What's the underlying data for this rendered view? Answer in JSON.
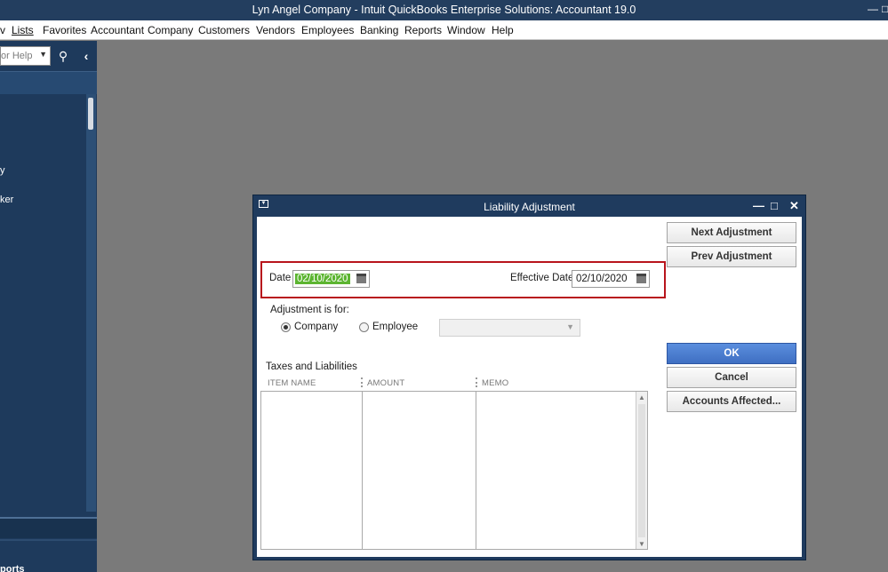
{
  "app": {
    "window_title": "Lyn Angel Company  - Intuit QuickBooks Enterprise Solutions: Accountant 19.0"
  },
  "menu": {
    "items": [
      {
        "id": "view-partial",
        "label": "v"
      },
      {
        "id": "lists",
        "label": "Lists"
      },
      {
        "id": "favorites",
        "label": "Favorites"
      },
      {
        "id": "accountant",
        "label": "Accountant"
      },
      {
        "id": "company",
        "label": "Company"
      },
      {
        "id": "customers",
        "label": "Customers"
      },
      {
        "id": "vendors",
        "label": "Vendors"
      },
      {
        "id": "employees",
        "label": "Employees"
      },
      {
        "id": "banking",
        "label": "Banking"
      },
      {
        "id": "reports",
        "label": "Reports"
      },
      {
        "id": "window",
        "label": "Window"
      },
      {
        "id": "help",
        "label": "Help"
      }
    ]
  },
  "sidebar": {
    "search_placeholder": "or Help",
    "nav_partial_1": "y",
    "nav_partial_2": "ker",
    "bottom_partial": "ports"
  },
  "dialog": {
    "title": "Liability Adjustment",
    "date_label": "Date",
    "date_value": "02/10/2020",
    "effective_date_label": "Effective Date",
    "effective_date_value": "02/10/2020",
    "adjustment_for_label": "Adjustment is for:",
    "radio_company": "Company",
    "radio_employee": "Employee",
    "employee_selected": "",
    "section_title": "Taxes and Liabilities",
    "columns": [
      "ITEM NAME",
      "AMOUNT",
      "MEMO"
    ],
    "buttons": {
      "next_adjustment": "Next Adjustment",
      "prev_adjustment": "Prev Adjustment",
      "ok": "OK",
      "cancel": "Cancel",
      "accounts_affected": "Accounts Affected..."
    }
  },
  "colors": {
    "title_bar": "#233e5f",
    "highlight_border": "#b8141c",
    "ok_button": "#4a7ccd",
    "date_selection": "#5cb531"
  }
}
